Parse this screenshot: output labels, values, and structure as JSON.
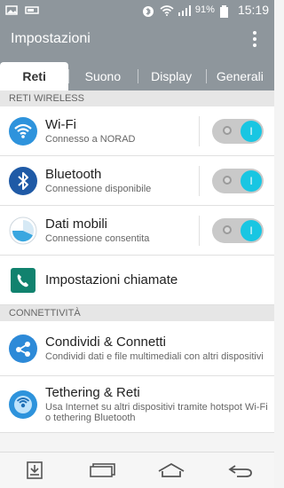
{
  "status": {
    "battery": "91%",
    "time": "15:19"
  },
  "appbar": {
    "title": "Impostazioni"
  },
  "tabs": [
    {
      "label": "Reti"
    },
    {
      "label": "Suono"
    },
    {
      "label": "Display"
    },
    {
      "label": "Generali"
    }
  ],
  "sections": {
    "wireless": "RETI WIRELESS",
    "connectivity": "CONNETTIVITÀ"
  },
  "items": [
    {
      "title": "Wi-Fi",
      "subtitle": "Connesso a NORAD"
    },
    {
      "title": "Bluetooth",
      "subtitle": "Connessione disponibile"
    },
    {
      "title": "Dati mobili",
      "subtitle": "Connessione consentita"
    },
    {
      "title": "Impostazioni chiamate"
    },
    {
      "title": "Condividi & Connetti",
      "subtitle": "Condividi dati e file multimediali con altri dispositivi"
    },
    {
      "title": "Tethering & Reti",
      "subtitle": "Usa Internet su altri dispositivi tramite hotspot Wi-Fi o tethering Bluetooth"
    }
  ],
  "toggle_symbol": "I"
}
